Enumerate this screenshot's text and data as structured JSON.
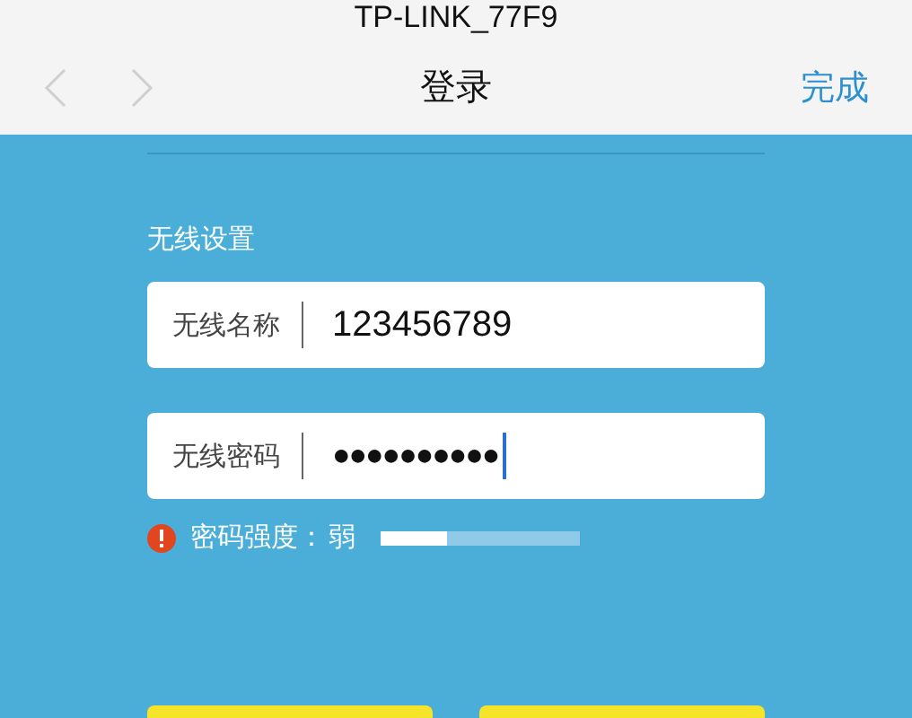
{
  "status_bar": {
    "title": "TP-LINK_77F9"
  },
  "nav": {
    "back_disabled": true,
    "forward_disabled": true,
    "title": "登录",
    "action": "完成"
  },
  "section": {
    "label": "无线设置"
  },
  "fields": [
    {
      "label": "无线名称",
      "value": "123456789",
      "focused": false
    },
    {
      "label": "无线密码",
      "value": "●●●●●●●●●●",
      "focused": true
    }
  ],
  "strength": {
    "label": "密码强度：",
    "value": "弱",
    "level": 0.33
  },
  "bottom_buttons": [
    {
      "kind": "button"
    },
    {
      "kind": "button"
    }
  ]
}
